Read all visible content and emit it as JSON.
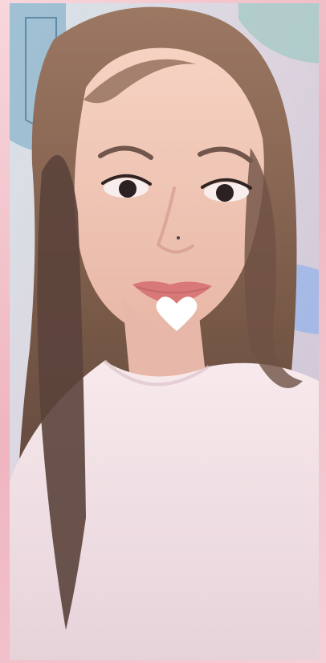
{
  "scene": {
    "subject": "selfie",
    "overlay_icon": "heart-icon",
    "colors": {
      "frame_pink": "#f4c9cf",
      "heart": "#ffffff",
      "shirt": "#f2dde1",
      "hair": "#8b6450",
      "skin": "#f1c7b5",
      "lips": "#d87978"
    }
  }
}
